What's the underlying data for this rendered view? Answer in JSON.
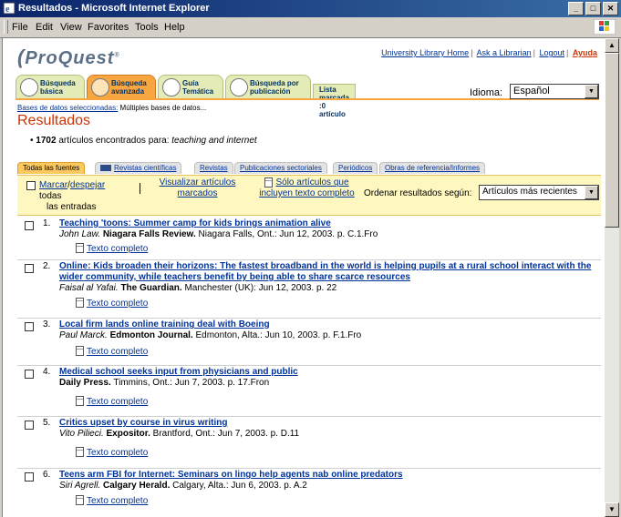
{
  "window": {
    "title": "Resultados - Microsoft Internet Explorer"
  },
  "menu": [
    "File",
    "Edit",
    "View",
    "Favorites",
    "Tools",
    "Help"
  ],
  "logo": "ProQuest",
  "toplinks": {
    "library": "University Library Home",
    "ask": "Ask a Librarian",
    "logout": "Logout",
    "help": "Ayuda"
  },
  "tabs": [
    {
      "l1": "Búsqueda",
      "l2": "básica"
    },
    {
      "l1": "Búsqueda",
      "l2": "avanzada"
    },
    {
      "l1": "Guía",
      "l2": "Temática"
    },
    {
      "l1": "Búsqueda por",
      "l2": "publicación"
    }
  ],
  "marked_list": "Lista marcada :0 artículo",
  "language": {
    "label": "Idioma:",
    "value": "Español"
  },
  "databases": {
    "link": "Bases de datos seleccionadas:",
    "value": "Múltiples bases de datos..."
  },
  "heading": "Resultados",
  "count": {
    "number": "1702",
    "text": "artículos encontrados para:",
    "query": "teaching and internet"
  },
  "source_tabs": [
    "Todas las fuentes",
    "Revistas científicas",
    "Revistas",
    "Publicaciones sectoriales",
    "Periódicos",
    "Obras de referencia/Informes"
  ],
  "toolbar": {
    "mark": "Marcar",
    "slash": "/",
    "unmark": "despejar",
    "mark_rest1": "todas",
    "mark_rest2": "las entradas",
    "view1": "Visualizar artículos",
    "view2": "marcados",
    "full1": "Sólo artículos que",
    "full2": "incluyen texto completo",
    "sort_label": "Ordenar resultados según:",
    "sort_value": "Artículos más recientes"
  },
  "full_text_label": "Texto completo",
  "results": [
    {
      "num": "1.",
      "title": "Teaching 'toons: Summer camp for kids brings animation alive",
      "author": "John Law.",
      "pub": "Niagara Falls Review.",
      "details": "Niagara Falls, Ont.: Jun 12, 2003. p. C.1.Fro"
    },
    {
      "num": "2.",
      "title": "Online: Kids broaden their horizons: The fastest broadband in the world is helping pupils at a rural school interact with the wider community, while teachers benefit by being able to share scarce resources",
      "author": "Faisal al Yafai.",
      "pub": "The Guardian.",
      "details": "Manchester (UK): Jun 12, 2003. p. 22"
    },
    {
      "num": "3.",
      "title": "Local firm lands online training deal with Boeing",
      "author": "Paul Marck.",
      "pub": "Edmonton Journal.",
      "details": "Edmonton, Alta.: Jun 10, 2003. p. F.1.Fro"
    },
    {
      "num": "4.",
      "title": "Medical school seeks input from physicians and public",
      "author": "",
      "pub": "Daily Press.",
      "details": "Timmins, Ont.: Jun 7, 2003. p. 17.Fron"
    },
    {
      "num": "5.",
      "title": "Critics upset by course in virus writing",
      "author": "Vito Pilieci.",
      "pub": "Expositor.",
      "details": "Brantford, Ont.: Jun 7, 2003. p. D.11"
    },
    {
      "num": "6.",
      "title": "Teens arm FBI for Internet: Seminars on lingo help agents nab online predators",
      "author": "Siri Agrell.",
      "pub": "Calgary Herald.",
      "details": "Calgary, Alta.: Jun 6, 2003. p. A.2"
    }
  ]
}
